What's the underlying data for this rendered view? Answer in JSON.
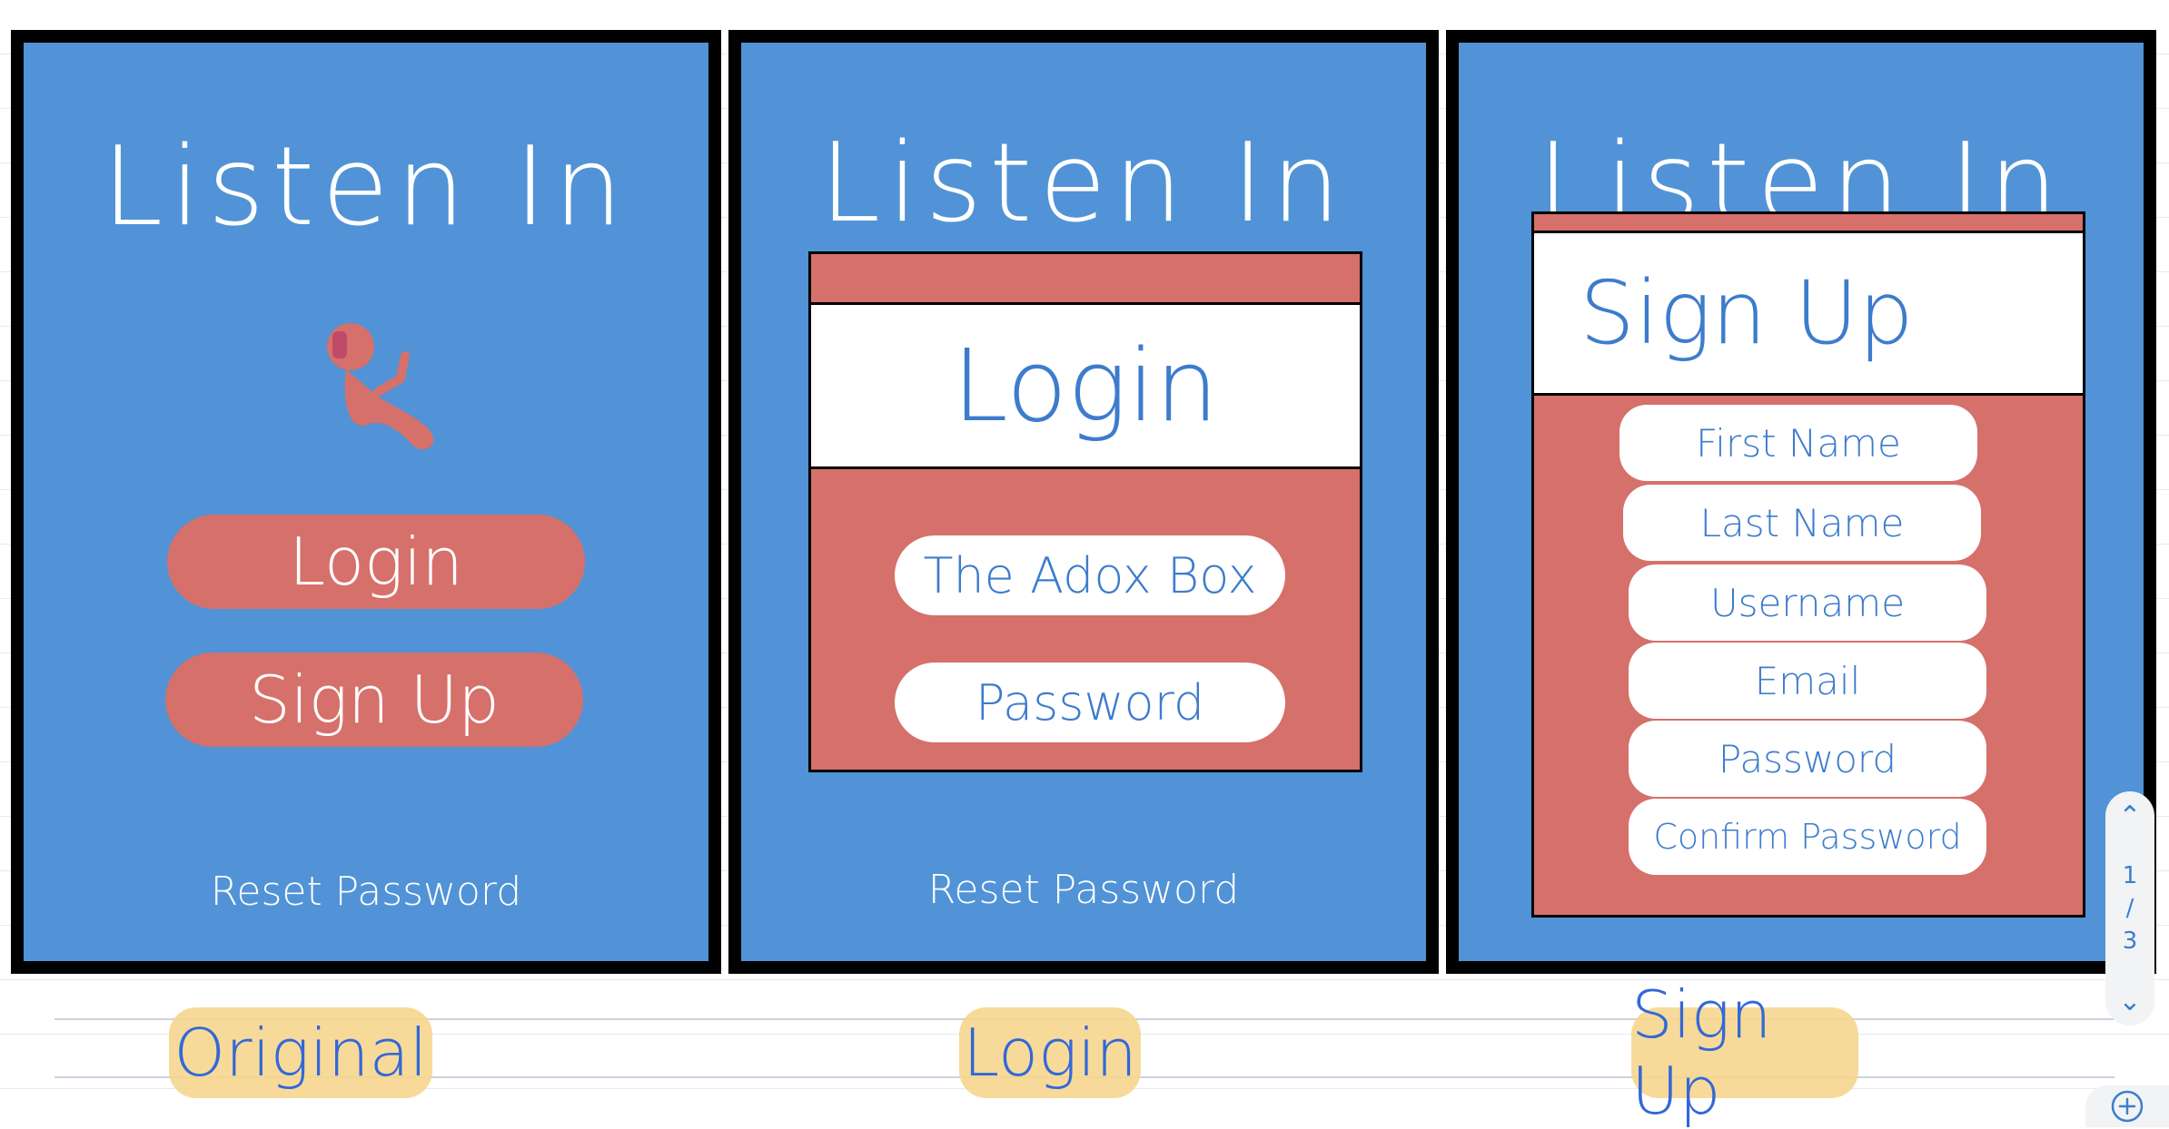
{
  "app_title": "Listen In",
  "panels": {
    "original": {
      "title": "Listen In",
      "login_label": "Login",
      "signup_label": "Sign Up",
      "reset_label": "Reset Password"
    },
    "login": {
      "title": "Listen In",
      "card_title": "Login",
      "username_value": "The Adox Box",
      "password_placeholder": "Password",
      "reset_label": "Reset Password"
    },
    "signup": {
      "title": "Listen In",
      "card_title": "Sign Up",
      "fields": [
        "First Name",
        "Last Name",
        "Username",
        "Email",
        "Password",
        "Confirm Password"
      ]
    }
  },
  "captions": {
    "original": "Original",
    "login": "Login",
    "signup": "Sign Up"
  },
  "pager": {
    "current": "1",
    "separator": "/",
    "total": "3"
  },
  "colors": {
    "panel_blue": "#5193d6",
    "accent_red": "#d6706a",
    "text_blue": "#3d7ccd",
    "highlight": "#f6d68e"
  },
  "icons": [
    "listener-logo-icon",
    "chevron-up-icon",
    "chevron-down-icon",
    "add-page-icon"
  ]
}
